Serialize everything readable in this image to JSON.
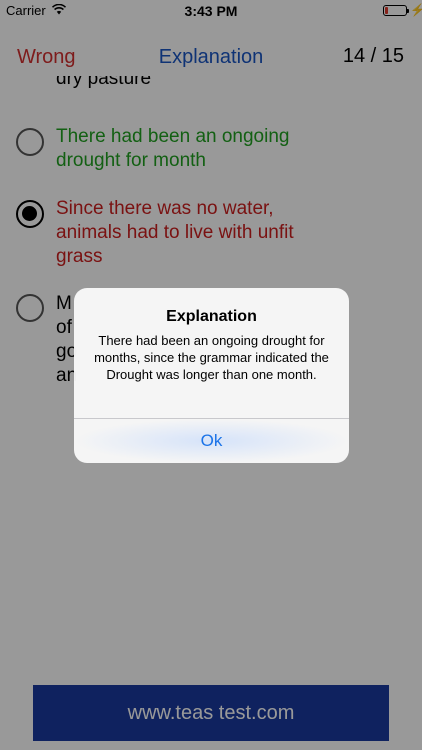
{
  "status_bar": {
    "carrier": "Carrier",
    "time": "3:43 PM",
    "wifi_icon": "wifi-icon",
    "battery_icon": "battery-icon",
    "charge_icon": "⚡",
    "battery_level": 0.15,
    "battery_color": "#e23b2e"
  },
  "nav": {
    "left_label": "Wrong",
    "title": "Explanation",
    "progress": "14 / 15",
    "left_color": "#d32f2f",
    "title_color": "#1a56c4"
  },
  "question": {
    "partial_text": "dry pasture"
  },
  "options": [
    {
      "text": "There had been an ongoing drought for month",
      "color": "#20a020",
      "selected": false
    },
    {
      "text": "Since there was no water, animals had to live with unfit grass",
      "color": "#cc1f1f",
      "selected": true
    },
    {
      "text": "M... of... go... an...",
      "visible_fragments": [
        "M",
        "of",
        "go",
        "an"
      ],
      "color": "#000000",
      "selected": false
    }
  ],
  "footer": {
    "label": "www.teas test.com",
    "color": "#1a3a9e"
  },
  "dialog": {
    "title": "Explanation",
    "message": "There had been an ongoing drought for months, since the grammar indicated the Drought was longer than one month.",
    "button_label": "Ok",
    "button_color": "#1a73e8"
  }
}
